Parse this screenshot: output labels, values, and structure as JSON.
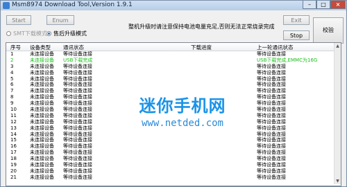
{
  "window": {
    "title": "Msm8974 Download Tool,Version 1.9.1"
  },
  "toolbar": {
    "start_label": "Start",
    "enum_label": "Enum",
    "exit_label": "Exit",
    "stop_label": "Stop",
    "verify_label": "校验",
    "notice": "整机升级时请注意保持电池电量充足,否则无法正常烧录完成"
  },
  "modes": {
    "smt_label": "SMT下载模式",
    "after_sale_label": "售后升级模式",
    "selected": "after_sale"
  },
  "table": {
    "columns": [
      "序号",
      "设备类型",
      "通讯状态",
      "下载进度",
      "上一轮通讯状态"
    ],
    "rows": [
      {
        "no": "1",
        "type": "未连接设备",
        "comm": "等待设备连接",
        "progress": "",
        "last": "等待设备连接",
        "status": "normal"
      },
      {
        "no": "2",
        "type": "未连接设备",
        "comm": "USB下载完成",
        "progress": "",
        "last": "USB下载完成,EMMC为16G",
        "status": "ok"
      },
      {
        "no": "3",
        "type": "未连接设备",
        "comm": "等待设备连接",
        "progress": "",
        "last": "等待设备连接",
        "status": "normal"
      },
      {
        "no": "4",
        "type": "未连接设备",
        "comm": "等待设备连接",
        "progress": "",
        "last": "等待设备连接",
        "status": "normal"
      },
      {
        "no": "5",
        "type": "未连接设备",
        "comm": "等待设备连接",
        "progress": "",
        "last": "等待设备连接",
        "status": "normal"
      },
      {
        "no": "6",
        "type": "未连接设备",
        "comm": "等待设备连接",
        "progress": "",
        "last": "等待设备连接",
        "status": "normal"
      },
      {
        "no": "7",
        "type": "未连接设备",
        "comm": "等待设备连接",
        "progress": "",
        "last": "等待设备连接",
        "status": "normal"
      },
      {
        "no": "8",
        "type": "未连接设备",
        "comm": "等待设备连接",
        "progress": "",
        "last": "等待设备连接",
        "status": "normal"
      },
      {
        "no": "9",
        "type": "未连接设备",
        "comm": "等待设备连接",
        "progress": "",
        "last": "等待设备连接",
        "status": "normal"
      },
      {
        "no": "10",
        "type": "未连接设备",
        "comm": "等待设备连接",
        "progress": "",
        "last": "等待设备连接",
        "status": "normal"
      },
      {
        "no": "11",
        "type": "未连接设备",
        "comm": "等待设备连接",
        "progress": "",
        "last": "等待设备连接",
        "status": "normal"
      },
      {
        "no": "12",
        "type": "未连接设备",
        "comm": "等待设备连接",
        "progress": "",
        "last": "等待设备连接",
        "status": "normal"
      },
      {
        "no": "13",
        "type": "未连接设备",
        "comm": "等待设备连接",
        "progress": "",
        "last": "等待设备连接",
        "status": "normal"
      },
      {
        "no": "14",
        "type": "未连接设备",
        "comm": "等待设备连接",
        "progress": "",
        "last": "等待设备连接",
        "status": "normal"
      },
      {
        "no": "15",
        "type": "未连接设备",
        "comm": "等待设备连接",
        "progress": "",
        "last": "等待设备连接",
        "status": "normal"
      },
      {
        "no": "16",
        "type": "未连接设备",
        "comm": "等待设备连接",
        "progress": "",
        "last": "等待设备连接",
        "status": "normal"
      },
      {
        "no": "17",
        "type": "未连接设备",
        "comm": "等待设备连接",
        "progress": "",
        "last": "等待设备连接",
        "status": "normal"
      },
      {
        "no": "18",
        "type": "未连接设备",
        "comm": "等待设备连接",
        "progress": "",
        "last": "等待设备连接",
        "status": "normal"
      },
      {
        "no": "19",
        "type": "未连接设备",
        "comm": "等待设备连接",
        "progress": "",
        "last": "等待设备连接",
        "status": "normal"
      },
      {
        "no": "20",
        "type": "未连接设备",
        "comm": "等待设备连接",
        "progress": "",
        "last": "等待设备连接",
        "status": "normal"
      },
      {
        "no": "21",
        "type": "未连接设备",
        "comm": "等待设备连接",
        "progress": "",
        "last": "等待设备连接",
        "status": "normal"
      }
    ]
  },
  "watermark": {
    "logo_text": "迷你手机网",
    "url": "www.netded.com"
  },
  "colors": {
    "ok_text": "#1bbf1b",
    "watermark": "#1a93e8",
    "close_button": "#c64b3b"
  }
}
